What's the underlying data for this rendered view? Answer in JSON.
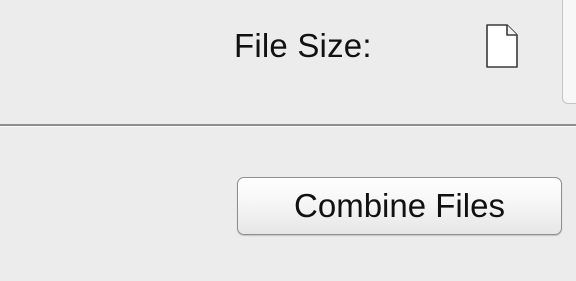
{
  "file_info": {
    "file_size_label": "File Size:",
    "file_icon": "document-icon"
  },
  "actions": {
    "combine_files_label": "Combine Files"
  }
}
